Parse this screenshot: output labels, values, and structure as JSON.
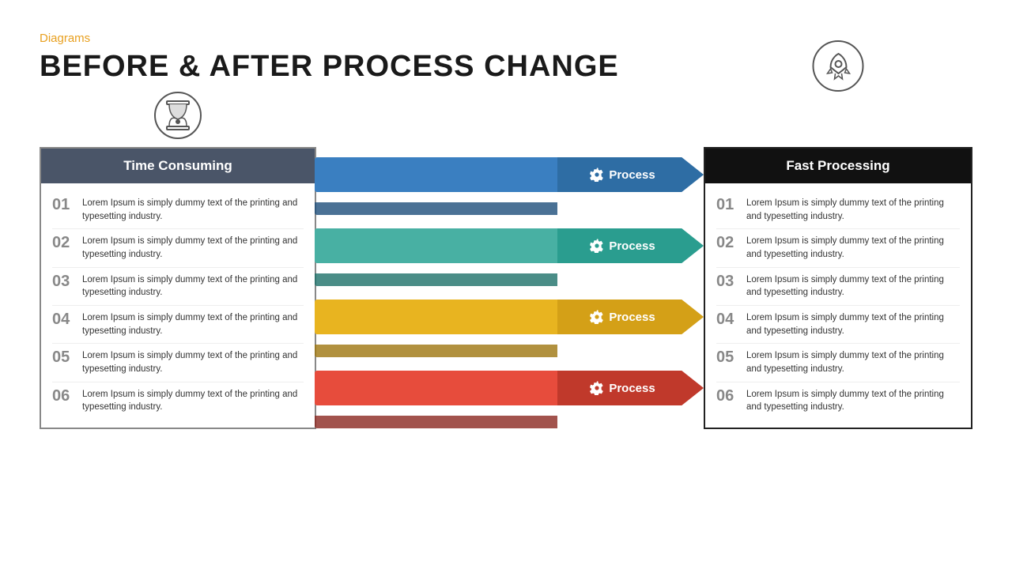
{
  "slide": {
    "category": "Diagrams",
    "title": "BEFORE & AFTER PROCESS CHANGE",
    "left_panel": {
      "icon_name": "hourglass-icon",
      "header": "Time Consuming",
      "items": [
        {
          "num": "01",
          "text": "Lorem Ipsum is simply dummy text of the printing and typesetting industry."
        },
        {
          "num": "02",
          "text": "Lorem Ipsum is simply dummy text of the printing and typesetting industry."
        },
        {
          "num": "03",
          "text": "Lorem Ipsum is simply dummy text of the printing and typesetting industry."
        },
        {
          "num": "04",
          "text": "Lorem Ipsum is simply dummy text of the printing and typesetting industry."
        },
        {
          "num": "05",
          "text": "Lorem Ipsum is simply dummy text of the printing and typesetting industry."
        },
        {
          "num": "06",
          "text": "Lorem Ipsum is simply dummy text of the printing and typesetting industry."
        }
      ]
    },
    "processes": [
      {
        "label": "Process",
        "color": "#2e6da4",
        "fold": "#1d4e7a"
      },
      {
        "label": "Process",
        "color": "#2a9d8f",
        "fold": "#1d7169"
      },
      {
        "label": "Process",
        "color": "#d4a017",
        "fold": "#9e760f"
      },
      {
        "label": "Process",
        "color": "#c0392b",
        "fold": "#8b2820"
      }
    ],
    "right_panel": {
      "icon_name": "rocket-icon",
      "header": "Fast Processing",
      "items": [
        {
          "num": "01",
          "text": "Lorem Ipsum is simply dummy text of the printing and typesetting industry."
        },
        {
          "num": "02",
          "text": "Lorem Ipsum is simply dummy text of the printing and typesetting industry."
        },
        {
          "num": "03",
          "text": "Lorem Ipsum is simply dummy text of the printing and typesetting industry."
        },
        {
          "num": "04",
          "text": "Lorem Ipsum is simply dummy text of the printing and typesetting industry."
        },
        {
          "num": "05",
          "text": "Lorem Ipsum is simply dummy text of the printing and typesetting industry."
        },
        {
          "num": "06",
          "text": "Lorem Ipsum is simply dummy text of the printing and typesetting industry."
        }
      ]
    }
  }
}
